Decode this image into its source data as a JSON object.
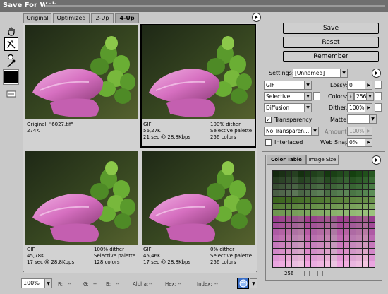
{
  "window": {
    "title": "Save For Web"
  },
  "tabs": [
    "Original",
    "Optimized",
    "2-Up",
    "4-Up"
  ],
  "panels": [
    {
      "l1a": "Original: \"6027.tif\"",
      "l1b": "",
      "l2a": "274K",
      "l2b": "",
      "l3a": "",
      "l3b": ""
    },
    {
      "l1a": "GIF",
      "l1b": "100% dither",
      "l2a": "56,27K",
      "l2b": "Selective palette",
      "l3a": "21 sec @ 28.8Kbps",
      "l3b": "256 colors"
    },
    {
      "l1a": "GIF",
      "l1b": "100% dither",
      "l2a": "45,78K",
      "l2b": "Selective palette",
      "l3a": "17 sec @ 28.8Kbps",
      "l3b": "128 colors"
    },
    {
      "l1a": "GIF",
      "l1b": "0% dither",
      "l2a": "45,46K",
      "l2b": "Selective palette",
      "l3a": "17 sec @ 28.8Kbps",
      "l3b": "256 colors"
    }
  ],
  "buttons": {
    "save": "Save",
    "reset": "Reset",
    "remember": "Remember"
  },
  "settings": {
    "label": "Settings:",
    "value": "[Unnamed]",
    "format": "GIF",
    "reduction": "Selective",
    "dither_algo": "Diffusion",
    "transparency_label": "Transparency",
    "transparency_checked": "✓",
    "matte_mode": "No Transparen...",
    "interlaced_label": "Interlaced",
    "lossy_label": "Lossy:",
    "lossy": "0",
    "colors_label": "Colors:",
    "colors": "256",
    "dither_label": "Dither:",
    "dither": "100%",
    "matte_label": "Matte:",
    "amount_label": "Amount:",
    "amount": "100%",
    "websnap_label": "Web Snap:",
    "websnap": "0%"
  },
  "color_table": {
    "tab_active": "Color Table",
    "tab_other": "Image Size",
    "count": "256"
  },
  "status": {
    "zoom": "100%",
    "r": "R:",
    "r_val": "--",
    "g": "G:",
    "g_val": "--",
    "b": "B:",
    "b_val": "--",
    "alpha": "Alpha:",
    "alpha_val": "--",
    "hex": "Hex:",
    "hex_val": "--",
    "index": "Index:",
    "index_val": "--"
  },
  "colors": {
    "accent": "#c9c9c9",
    "title_bar": "#6f6f6f"
  },
  "icons": [
    "hand-tool-icon",
    "slice-select-tool-icon",
    "zoom-tool-icon",
    "eyedropper-tool-icon",
    "preview-in-browser-icon",
    "menu-arrow-icon"
  ]
}
